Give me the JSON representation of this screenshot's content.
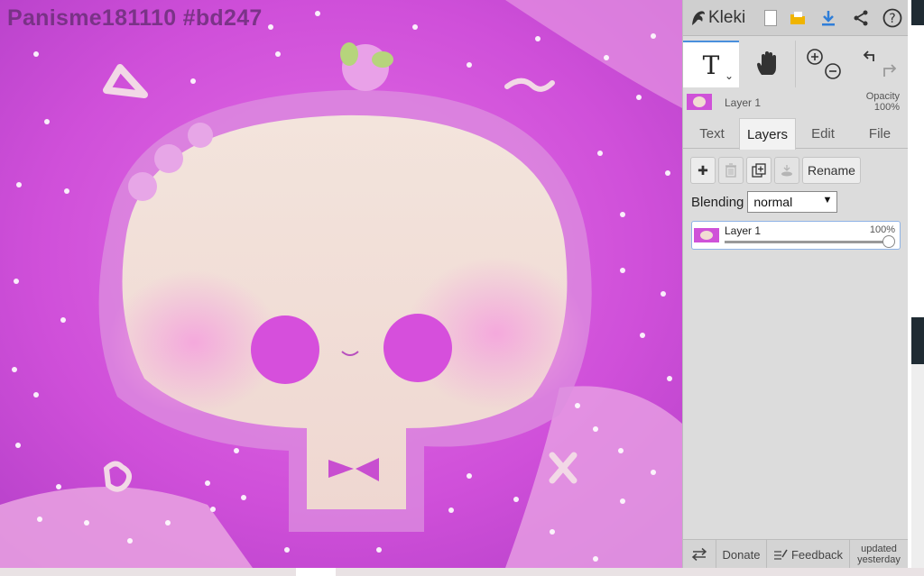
{
  "canvas": {
    "watermark": "Panisme181110 #bd247"
  },
  "app": {
    "name": "Kleki"
  },
  "topbar": {
    "icons": [
      "new-image-icon",
      "open-image-icon",
      "save-icon",
      "share-icon",
      "help-icon"
    ]
  },
  "tools": {
    "text_glyph": "T",
    "dropdown_glyph": "⌄"
  },
  "layer_summary": {
    "name": "Layer 1",
    "opacity_label": "Opacity",
    "opacity_value": "100%"
  },
  "tabs": [
    {
      "label": "Text",
      "active": false
    },
    {
      "label": "Layers",
      "active": true
    },
    {
      "label": "Edit",
      "active": false
    },
    {
      "label": "File",
      "active": false
    }
  ],
  "layer_tools": {
    "add": "✚",
    "rename": "Rename"
  },
  "blending": {
    "label": "Blending",
    "value": "normal"
  },
  "layers": [
    {
      "name": "Layer 1",
      "opacity": "100%"
    }
  ],
  "bottombar": {
    "donate": "Donate",
    "feedback": "Feedback",
    "updated": "updated yesterday"
  },
  "colors": {
    "accent": "#4a8fdc",
    "panel": "#dcdcdc",
    "canvas_magenta": "#c23fcf",
    "skull": "#f1dcd3"
  }
}
